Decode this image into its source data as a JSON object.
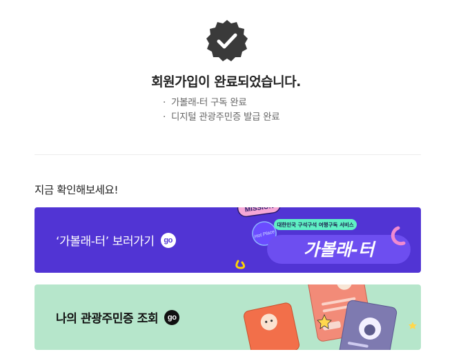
{
  "success": {
    "icon": "check-badge-icon",
    "title": "회원가입이 완료되었습니다.",
    "items": [
      "가볼래-터 구독 완료",
      "디지털 관광주민증 발급 완료"
    ]
  },
  "section": {
    "title": "지금 확인해보세요!"
  },
  "banners": [
    {
      "label": "‘가볼래-터’ 보러가기",
      "go": "go",
      "background": "#5134d4",
      "art": {
        "sticker_top": "MISSION",
        "tag": "대한민국 구석구석 여행구독 서비스",
        "hot_place": "Hot Place",
        "logo": "가볼래-터"
      }
    },
    {
      "label": "나의 관광주민증 조회",
      "go": "go",
      "background": "#b6e6cb"
    }
  ]
}
